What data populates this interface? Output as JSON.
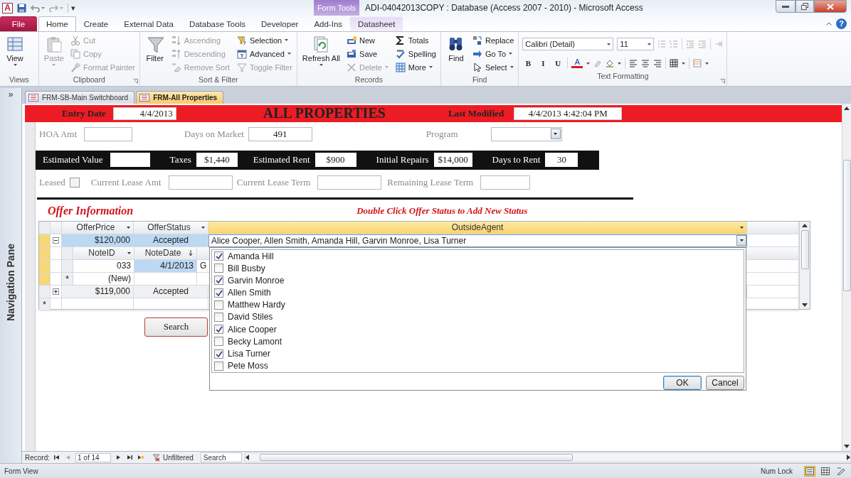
{
  "title_bar": {
    "app_icon": "A",
    "customize": "▾",
    "context_label": "Form Tools",
    "title": "ADI-04042013COPY : Database (Access 2007 - 2010)  -  Microsoft Access"
  },
  "ribbon_tabs": [
    {
      "label": "File",
      "kind": "file",
      "selected": false
    },
    {
      "label": "Home",
      "kind": "normal",
      "selected": true
    },
    {
      "label": "Create",
      "kind": "normal",
      "selected": false
    },
    {
      "label": "External Data",
      "kind": "normal",
      "selected": false
    },
    {
      "label": "Database Tools",
      "kind": "normal",
      "selected": false
    },
    {
      "label": "Developer",
      "kind": "normal",
      "selected": false
    },
    {
      "label": "Add-Ins",
      "kind": "normal",
      "selected": false
    },
    {
      "label": "Datasheet",
      "kind": "context",
      "selected": false
    }
  ],
  "help": "?",
  "ribbon_groups": [
    {
      "label": "Views",
      "kind": "buttons",
      "launcher": false,
      "items": [
        {
          "label": "View",
          "kind": "large",
          "dropdown": true,
          "disabled": false
        }
      ]
    },
    {
      "label": "Clipboard",
      "kind": "buttons",
      "launcher": true,
      "items": [
        {
          "label": "Paste",
          "kind": "large",
          "dropdown": true,
          "disabled": true
        },
        {
          "label": "Cut",
          "kind": "small",
          "dropdown": false,
          "disabled": true
        },
        {
          "label": "Copy",
          "kind": "small",
          "dropdown": false,
          "disabled": true
        },
        {
          "label": "Format Painter",
          "kind": "small",
          "dropdown": false,
          "disabled": true
        }
      ]
    },
    {
      "label": "Sort & Filter",
      "kind": "buttons",
      "launcher": false,
      "items": [
        {
          "label": "Filter",
          "kind": "large",
          "dropdown": false,
          "disabled": false
        },
        {
          "label": "Ascending",
          "kind": "small",
          "dropdown": false,
          "disabled": true
        },
        {
          "label": "Descending",
          "kind": "small",
          "dropdown": false,
          "disabled": true
        },
        {
          "label": "Remove Sort",
          "kind": "small",
          "dropdown": false,
          "disabled": true
        },
        {
          "label": "Selection",
          "kind": "small",
          "dropdown": true,
          "disabled": false
        },
        {
          "label": "Advanced",
          "kind": "small",
          "dropdown": true,
          "disabled": false
        },
        {
          "label": "Toggle Filter",
          "kind": "small",
          "dropdown": false,
          "disabled": true
        }
      ]
    },
    {
      "label": "Records",
      "kind": "buttons",
      "launcher": false,
      "items": [
        {
          "label": "Refresh All",
          "kind": "large",
          "dropdown": true,
          "disabled": false
        },
        {
          "label": "New",
          "kind": "small",
          "dropdown": false,
          "disabled": false
        },
        {
          "label": "Save",
          "kind": "small",
          "dropdown": false,
          "disabled": false
        },
        {
          "label": "Delete",
          "kind": "small",
          "dropdown": true,
          "disabled": true
        },
        {
          "label": "Totals",
          "kind": "small",
          "dropdown": false,
          "disabled": false
        },
        {
          "label": "Spelling",
          "kind": "small",
          "dropdown": false,
          "disabled": false
        },
        {
          "label": "More",
          "kind": "small",
          "dropdown": true,
          "disabled": false
        }
      ]
    },
    {
      "label": "Find",
      "kind": "buttons",
      "launcher": false,
      "items": [
        {
          "label": "Find",
          "kind": "large",
          "dropdown": false,
          "disabled": false
        },
        {
          "label": "Replace",
          "kind": "small",
          "dropdown": false,
          "disabled": false
        },
        {
          "label": "Go To",
          "kind": "small",
          "dropdown": true,
          "disabled": false
        },
        {
          "label": "Select",
          "kind": "small",
          "dropdown": true,
          "disabled": false
        }
      ]
    },
    {
      "label": "Text Formatting",
      "kind": "format",
      "launcher": true,
      "font": "Calibri (Detail)",
      "size": "11",
      "style_buttons": [
        "B",
        "I",
        "U"
      ],
      "font_color": "A"
    }
  ],
  "navigation_pane": {
    "toggle": "»",
    "label": "Navigation Pane"
  },
  "document_tabs": [
    {
      "label": "FRM-SB-Main Switchboard",
      "selected": false
    },
    {
      "label": "FRM-All Properties",
      "selected": true
    }
  ],
  "form": {
    "header": {
      "entry_date_label": "Entry Date",
      "entry_date": "4/4/2013",
      "title": "ALL PROPERTIES",
      "last_modified_label": "Last Modified",
      "last_modified": "4/4/2013 4:42:04 PM"
    },
    "row_1": [
      {
        "label": "HOA Amt",
        "kind": "text"
      },
      {
        "label": "Days on Market",
        "kind": "text",
        "value": "491"
      },
      {
        "label": "Program",
        "kind": "combo"
      }
    ],
    "estimates": [
      {
        "label": "Estimated Value"
      },
      {
        "label": "Taxes",
        "value": "$1,440"
      },
      {
        "label": "Estimated Rent",
        "value": "$900"
      },
      {
        "label": "Initial Repairs",
        "value": "$14,000"
      },
      {
        "label": "Days to Rent",
        "value": "30"
      }
    ],
    "lease": [
      {
        "label": "Leased",
        "kind": "checkbox",
        "checked": false
      },
      {
        "label": "Current Lease Amt",
        "kind": "text"
      },
      {
        "label": "Current Lease Term",
        "kind": "text"
      },
      {
        "label": "Remaining Lease Term",
        "kind": "text"
      }
    ],
    "offer_heading": "Offer Information",
    "offer_note": "Double Click Offer Status to Add New Status",
    "offers": {
      "columns": [
        {
          "label": "OfferPrice",
          "selected": false
        },
        {
          "label": "OfferStatus",
          "selected": false
        },
        {
          "label": "OutsideAgent",
          "selected": true
        }
      ],
      "rows": [
        {
          "cells": [
            "$120,000",
            "Accepted",
            "Alice Cooper, Allen Smith, Amanda Hill, Garvin Monroe, Lisa Turner"
          ],
          "selected": true,
          "expanded": true,
          "notes": {
            "columns": [
              "NoteID",
              "NoteDate"
            ],
            "rows": [
              {
                "cells": [
                  "033",
                  "4/1/2013",
                  "G"
                ],
                "selected": true
              }
            ],
            "new_row_marker": "*",
            "new_row": "(New)"
          }
        },
        {
          "cells": [
            "$119,000",
            "Accepted"
          ],
          "selected": false,
          "expanded": false
        }
      ],
      "new_row_marker": "*"
    },
    "agent_list": {
      "items": [
        {
          "name": "Amanda Hill",
          "checked": true
        },
        {
          "name": "Bill Busby",
          "checked": false
        },
        {
          "name": "Garvin Monroe",
          "checked": true
        },
        {
          "name": "Allen Smith",
          "checked": true
        },
        {
          "name": "Matthew Hardy",
          "checked": false
        },
        {
          "name": "David Stiles",
          "checked": false
        },
        {
          "name": "Alice Cooper",
          "checked": true
        },
        {
          "name": "Becky Lamont",
          "checked": false
        },
        {
          "name": "Lisa Turner",
          "checked": true
        },
        {
          "name": "Pete Moss",
          "checked": false
        }
      ],
      "buttons": [
        "OK",
        "Cancel"
      ]
    },
    "search_button": "Search"
  },
  "record_nav": {
    "label": "Record:",
    "position": "1 of 14",
    "filter": "Unfiltered",
    "search": "Search"
  },
  "status_bar": {
    "left": "Form View",
    "right": "Num Lock"
  }
}
